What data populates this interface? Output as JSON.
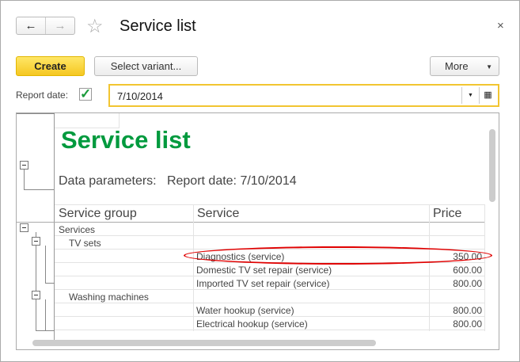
{
  "header": {
    "title": "Service list",
    "back": "←",
    "forward": "→",
    "close": "×"
  },
  "toolbar": {
    "create": "Create",
    "select_variant": "Select variant...",
    "more": "More"
  },
  "params": {
    "report_date_label": "Report date:",
    "report_date_checked": true,
    "report_date_value": "7/10/2014"
  },
  "report": {
    "title": "Service list",
    "parameters": "Data parameters:   Report date: 7/10/2014",
    "columns": [
      "Service group",
      "Service",
      "Price"
    ],
    "rows": [
      {
        "group": "Services",
        "service": "",
        "price": ""
      },
      {
        "group": "TV sets",
        "service": "",
        "price": ""
      },
      {
        "group": "",
        "service": "Diagnostics (service)",
        "price": "350.00"
      },
      {
        "group": "",
        "service": "Domestic TV set repair (service)",
        "price": "600.00"
      },
      {
        "group": "",
        "service": "Imported TV set repair (service)",
        "price": "800.00"
      },
      {
        "group": "Washing machines",
        "service": "",
        "price": ""
      },
      {
        "group": "",
        "service": "Water hookup (service)",
        "price": "800.00"
      },
      {
        "group": "",
        "service": "Electrical hookup (service)",
        "price": "800.00"
      }
    ],
    "title_color": "#009a3e",
    "highlight_color": "#e00000"
  }
}
